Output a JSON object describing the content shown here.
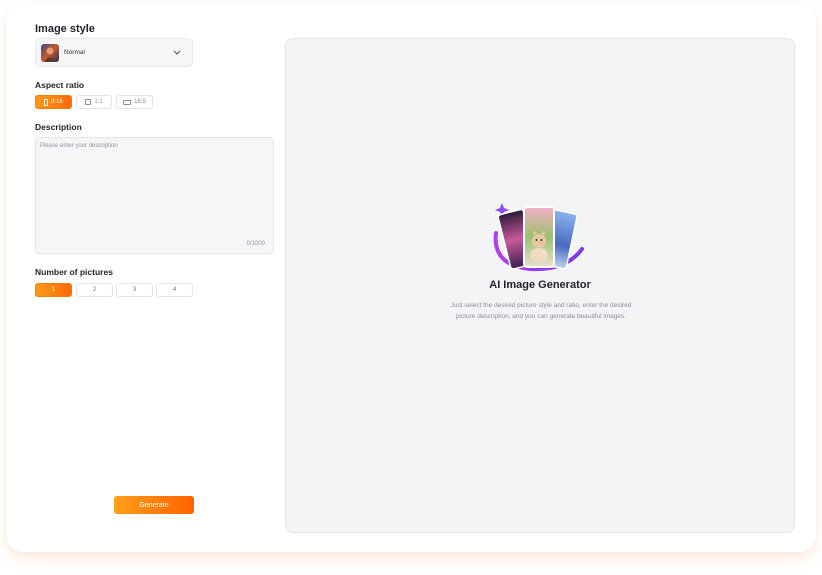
{
  "form": {
    "image_style": {
      "label": "Image style",
      "selected": "Normal",
      "thumb_icon": "style-thumbnail"
    },
    "aspect_ratio": {
      "label": "Aspect ratio",
      "options": [
        {
          "label": "9:16",
          "icon": "portrait-icon",
          "active": true
        },
        {
          "label": "1:1",
          "icon": "square-icon",
          "active": false
        },
        {
          "label": "16:9",
          "icon": "landscape-icon",
          "active": false
        }
      ]
    },
    "description": {
      "label": "Description",
      "placeholder": "Please enter your description",
      "value": "",
      "counter": "0/1000"
    },
    "number_of_pictures": {
      "label": "Number of pictures",
      "options": [
        "1",
        "2",
        "3",
        "4"
      ],
      "selected": "1"
    },
    "generate_label": "Generate"
  },
  "preview": {
    "illustration_icon": "ai-image-cards-illustration",
    "title": "AI Image Generator",
    "description": "Just select the desired picture style and ratio, enter the desired picture description, and you can generate beautiful images."
  },
  "colors": {
    "accent_start": "#ff9a1a",
    "accent_end": "#ff6a00",
    "panel_bg": "#f3f4f6",
    "text_muted": "#8a8f99"
  }
}
